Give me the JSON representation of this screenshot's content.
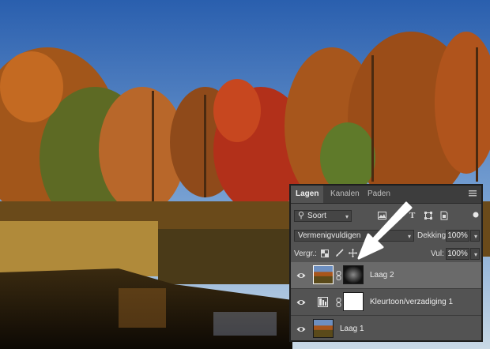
{
  "panel": {
    "tabs": [
      {
        "label": "Lagen"
      },
      {
        "label": "Kanalen"
      },
      {
        "label": "Paden"
      }
    ],
    "filter": {
      "selected": "Soort"
    },
    "blend_mode": {
      "selected": "Vermenigvuldigen"
    },
    "opacity": {
      "label": "Dekking:",
      "value": "100%"
    },
    "lock": {
      "label": "Vergr.:"
    },
    "fill": {
      "label": "Vul:",
      "value": "100%"
    },
    "layers": [
      {
        "name": "Laag 2",
        "selected": true
      },
      {
        "name": "Kleurtoon/verzadiging 1",
        "selected": false
      },
      {
        "name": "Laag 1",
        "selected": false
      }
    ]
  },
  "colors": {
    "panel_bg": "#535353",
    "selected_layer": "#6a6a6a",
    "tab_bar": "#3d3d3d"
  }
}
